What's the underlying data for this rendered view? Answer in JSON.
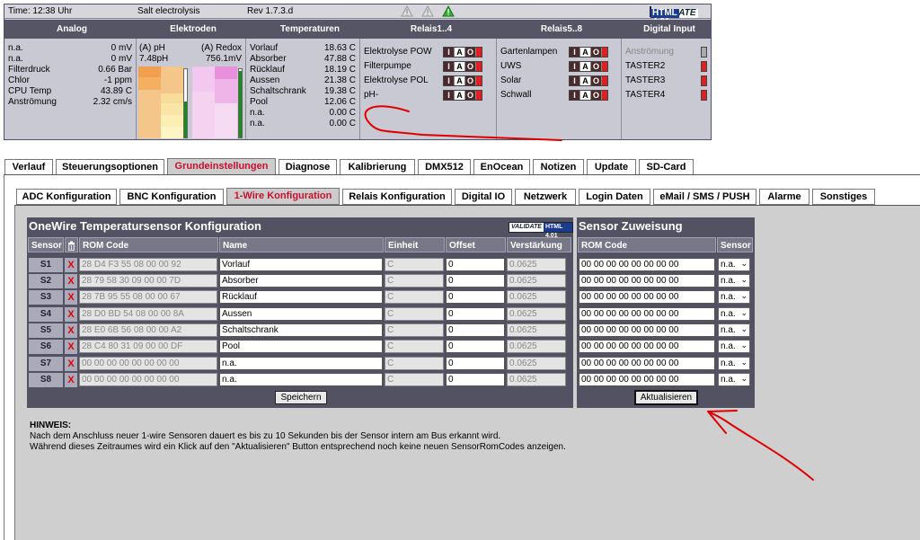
{
  "topbar": {
    "time": "Time: 12:38 Uhr",
    "product": "Salt electrolysis",
    "rev": "Rev 1.7.3.d",
    "badge_left": "VALIDATE",
    "badge_right": "HTML 4.01"
  },
  "headers": {
    "analog": "Analog",
    "elektroden": "Elektroden",
    "temperaturen": "Temperaturen",
    "relais1": "Relais1..4",
    "relais5": "Relais5..8",
    "digital": "Digital Input"
  },
  "analog": [
    {
      "label": "n.a.",
      "value": "0 mV"
    },
    {
      "label": "n.a.",
      "value": "0 mV"
    },
    {
      "label": "Filterdruck",
      "value": "0.66 Bar"
    },
    {
      "label": "Chlor",
      "value": "-1 ppm"
    },
    {
      "label": "CPU Temp",
      "value": "43.89 C"
    },
    {
      "label": "Anströmung",
      "value": "2.32 cm/s"
    }
  ],
  "elektroden": {
    "ph_label": "(A) pH",
    "ph_value": "7.48pH",
    "redox_label": "(A) Redox",
    "redox_value": "756.1mV"
  },
  "temperaturen": [
    {
      "label": "Vorlauf",
      "value": "18.63 C"
    },
    {
      "label": "Absorber",
      "value": "47.88 C"
    },
    {
      "label": "Rücklauf",
      "value": "18.19 C"
    },
    {
      "label": "Aussen",
      "value": "21.38 C"
    },
    {
      "label": "Schaltschrank",
      "value": "19.38 C"
    },
    {
      "label": "Pool",
      "value": "12.06 C"
    },
    {
      "label": "n.a.",
      "value": "0.00 C"
    },
    {
      "label": "n.a.",
      "value": "0.00 C"
    }
  ],
  "relais1": [
    "Elektrolyse POW",
    "Filterpumpe",
    "Elektrolyse POL",
    "pH-"
  ],
  "relais5": [
    "Gartenlampen",
    "UWS",
    "Solar",
    "Schwall"
  ],
  "iao": {
    "i": "I",
    "a": "A",
    "o": "O"
  },
  "digital": [
    "Anströmung",
    "TASTER2",
    "TASTER3",
    "TASTER4"
  ],
  "tabs_main": [
    "Verlauf",
    "Steuerungsoptionen",
    "Grundeinstellungen",
    "Diagnose",
    "Kalibrierung",
    "DMX512",
    "EnOcean",
    "Notizen",
    "Update",
    "SD-Card"
  ],
  "tabs_sub": [
    "ADC Konfiguration",
    "BNC Konfiguration",
    "1-Wire Konfiguration",
    "Relais Konfiguration",
    "Digital IO",
    "Netzwerk",
    "Login Daten",
    "eMail / SMS / PUSH",
    "Alarme",
    "Sonstiges"
  ],
  "table": {
    "title": "OneWire Temperatursensor Konfiguration",
    "columns": [
      "Sensor",
      "ROM Code",
      "Name",
      "Einheit",
      "Offset",
      "Verstärkung"
    ],
    "delete_glyph": "X",
    "rows": [
      {
        "sensor": "S1",
        "rom": "28 D4 F3 55 08 00 00 92",
        "name": "Vorlauf",
        "unit": "C",
        "offset": "0",
        "gain": "0.0625"
      },
      {
        "sensor": "S2",
        "rom": "28 79 58 30 09 00 00 7D",
        "name": "Absorber",
        "unit": "C",
        "offset": "0",
        "gain": "0.0625"
      },
      {
        "sensor": "S3",
        "rom": "28 7B 95 55 08 00 00 67",
        "name": "Rücklauf",
        "unit": "C",
        "offset": "0",
        "gain": "0.0625"
      },
      {
        "sensor": "S4",
        "rom": "28 D0 BD 54 08 00 00 8A",
        "name": "Aussen",
        "unit": "C",
        "offset": "0",
        "gain": "0.0625"
      },
      {
        "sensor": "S5",
        "rom": "28 E0 6B 56 08 00 00 A2",
        "name": "Schaltschrank",
        "unit": "C",
        "offset": "0",
        "gain": "0.0625"
      },
      {
        "sensor": "S6",
        "rom": "28 C4 80 31 09 00 00 DF",
        "name": "Pool",
        "unit": "C",
        "offset": "0",
        "gain": "0.0625"
      },
      {
        "sensor": "S7",
        "rom": "00 00 00 00 00 00 00 00",
        "name": "n.a.",
        "unit": "C",
        "offset": "0",
        "gain": "0.0625"
      },
      {
        "sensor": "S8",
        "rom": "00 00 00 00 00 00 00 00",
        "name": "n.a.",
        "unit": "C",
        "offset": "0",
        "gain": "0.0625"
      }
    ],
    "save": "Speichern"
  },
  "sensor_assign": {
    "title": "Sensor Zuweisung",
    "col_rom": "ROM Code",
    "col_sensor": "Sensor",
    "rom_value": "00 00 00 00 00 00 00 00",
    "sensor_value": "n.a.",
    "refresh": "Aktualisieren"
  },
  "hint": {
    "title": "HINWEIS:",
    "line1": "Nach dem Anschluss neuer 1-wire Sensoren dauert es bis zu 10 Sekunden bis der Sensor intern am Bus erkannt wird.",
    "line2": "Während dieses Zeitraumes wird ein Klick auf den \"Aktualisieren\" Button entsprechend noch keine neuen SensorRomCodes anzeigen."
  },
  "colors": {
    "header_bar": "#555566",
    "active_tab_text": "#c8102e",
    "annotation_red": "#e00000",
    "on_green": "#29a329"
  }
}
